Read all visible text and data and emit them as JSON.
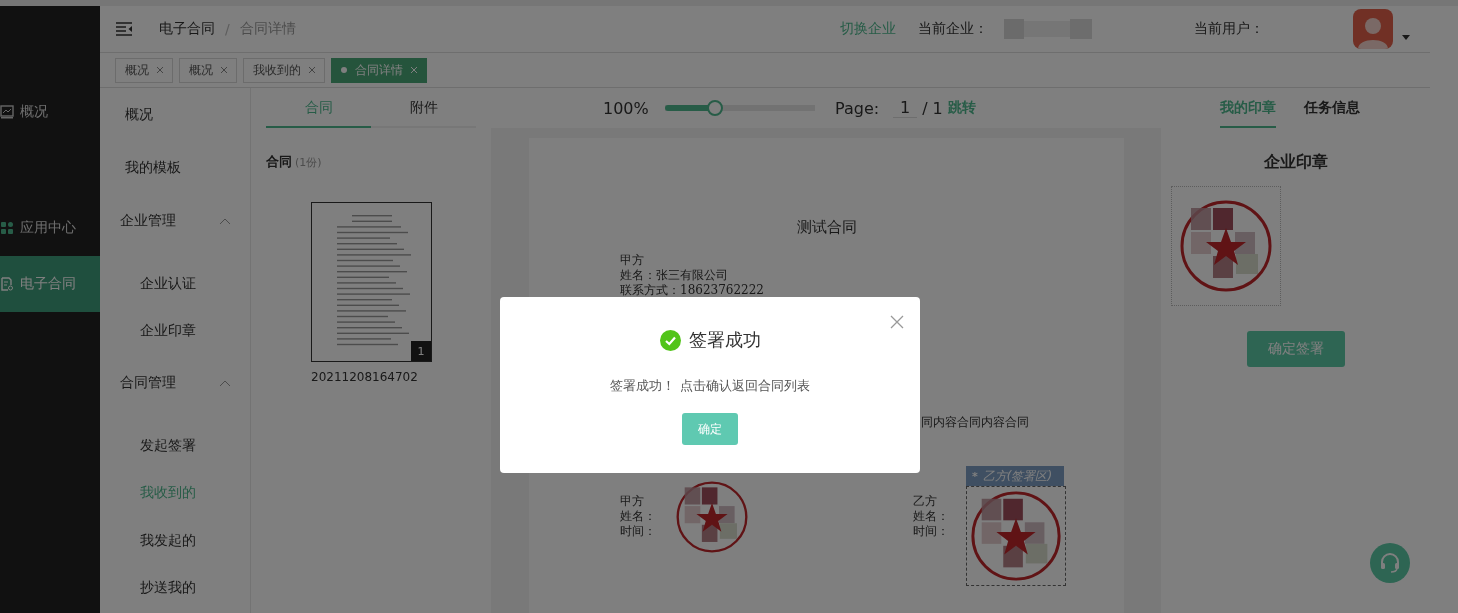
{
  "sidebar": {
    "items": [
      {
        "label": "概况",
        "selected": false
      },
      {
        "label": "应用中心",
        "selected": false
      },
      {
        "label": "电子合同",
        "selected": true
      }
    ]
  },
  "header": {
    "breadcrumb": [
      {
        "label": "电子合同",
        "current": false
      },
      {
        "label": "合同详情",
        "current": true
      }
    ],
    "separator": "/",
    "switch_link": "切换企业",
    "company_label": "当前企业：",
    "user_label": "当前用户："
  },
  "tags": [
    {
      "label": "概况",
      "selected": false
    },
    {
      "label": "概况",
      "selected": false
    },
    {
      "label": "我收到的",
      "selected": false
    },
    {
      "label": "合同详情",
      "selected": true
    }
  ],
  "submenu": {
    "items": [
      {
        "kind": "item",
        "label": "概况",
        "selected": false
      },
      {
        "kind": "item",
        "label": "我的模板",
        "selected": false
      },
      {
        "kind": "group",
        "label": "企业管理",
        "expanded": true,
        "children": [
          {
            "label": "企业认证",
            "selected": false
          },
          {
            "label": "企业印章",
            "selected": false
          }
        ]
      },
      {
        "kind": "group",
        "label": "合同管理",
        "expanded": true,
        "children": [
          {
            "label": "发起签署",
            "selected": false
          },
          {
            "label": "我收到的",
            "selected": true
          },
          {
            "label": "我发起的",
            "selected": false
          },
          {
            "label": "抄送我的",
            "selected": false
          }
        ]
      }
    ]
  },
  "doc_tabs": [
    {
      "label": "合同",
      "selected": true
    },
    {
      "label": "附件",
      "selected": false
    }
  ],
  "zoom": {
    "reading": "100%",
    "level": 0.33
  },
  "pager": {
    "label": "Page:",
    "value": "1",
    "total": "/ 1",
    "jump": "跳转"
  },
  "side_tabs": [
    {
      "label": "我的印章",
      "selected": true
    },
    {
      "label": "任务信息",
      "selected": false
    }
  ],
  "files": {
    "title": "合同",
    "count": "(1份)",
    "items": [
      {
        "badge": "1",
        "name": "20211208164702"
      }
    ]
  },
  "document": {
    "title": "测试合同",
    "party_lines": [
      "甲方",
      "姓名：张三有限公司",
      "联系方式：18623762222"
    ],
    "body_fragment": "同内容合同内容合同",
    "signatures": [
      {
        "lines": [
          "甲方",
          "姓名：",
          "时间："
        ]
      },
      {
        "lines": [
          "乙方",
          "姓名：",
          "时间："
        ],
        "zone_marker": "*",
        "zone_label": "乙方(签署区)"
      }
    ]
  },
  "seal_panel": {
    "title": "企业印章",
    "button": "确定签署"
  },
  "dialog": {
    "title": "签署成功",
    "message": "签署成功！ 点击确认返回合同列表",
    "confirm": "确定"
  }
}
